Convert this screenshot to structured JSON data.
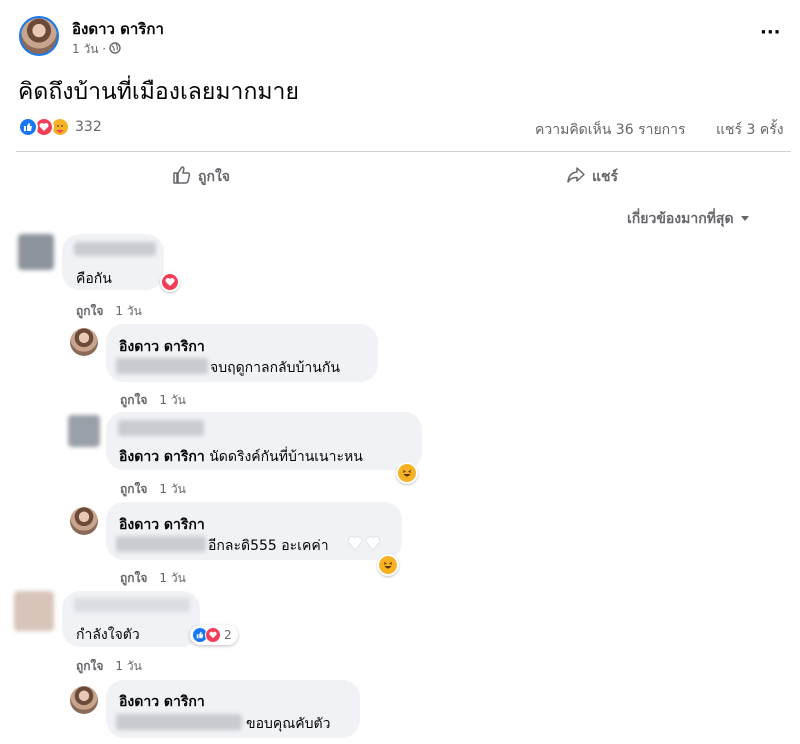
{
  "post": {
    "author": "อิงดาว ดาริกา",
    "time": "1 วัน ·",
    "text": "คิดถึงบ้านที่เมืองเลยมากมาย",
    "more": "···"
  },
  "stats": {
    "reaction_count": "332",
    "reaction_icons": [
      "like-icon",
      "love-icon",
      "care-icon"
    ],
    "comments": "ความคิดเห็น 36 รายการ",
    "shares": "แชร์ 3 ครั้ง"
  },
  "actions": {
    "like": "ถูกใจ",
    "share": "แชร์"
  },
  "sort": {
    "label": "เกี่ยวข้องมากที่สุด"
  },
  "comments": [
    {
      "author": "",
      "text": "คือกัน",
      "like": "ถูกใจ",
      "time": "1 วัน",
      "reaction": "love"
    },
    {
      "author": "อิงดาว ดาริกา",
      "text": "จบฤดูกาลกลับบ้านกัน",
      "like": "ถูกใจ",
      "time": "1 วัน"
    },
    {
      "author": "",
      "text": "อิงดาว ดาริกา นัดดริงค์กันที่บ้านเนาะหน",
      "mention": "อิงดาว ดาริกา",
      "rest": " นัดดริงค์กันที่บ้านเนาะหน",
      "like": "ถูกใจ",
      "time": "1 วัน",
      "reaction": "haha"
    },
    {
      "author": "อิงดาว ดาริกา",
      "text": "อีกละดิ555 อะเคค่า",
      "like": "ถูกใจ",
      "time": "1 วัน",
      "reaction": "haha"
    },
    {
      "author": "",
      "text": "กำลังใจตัว",
      "like": "ถูกใจ",
      "time": "1 วัน",
      "reaction_count": "2"
    },
    {
      "author": "อิงดาว ดาริกา",
      "text": "ขอบคุณคับตัว"
    }
  ]
}
